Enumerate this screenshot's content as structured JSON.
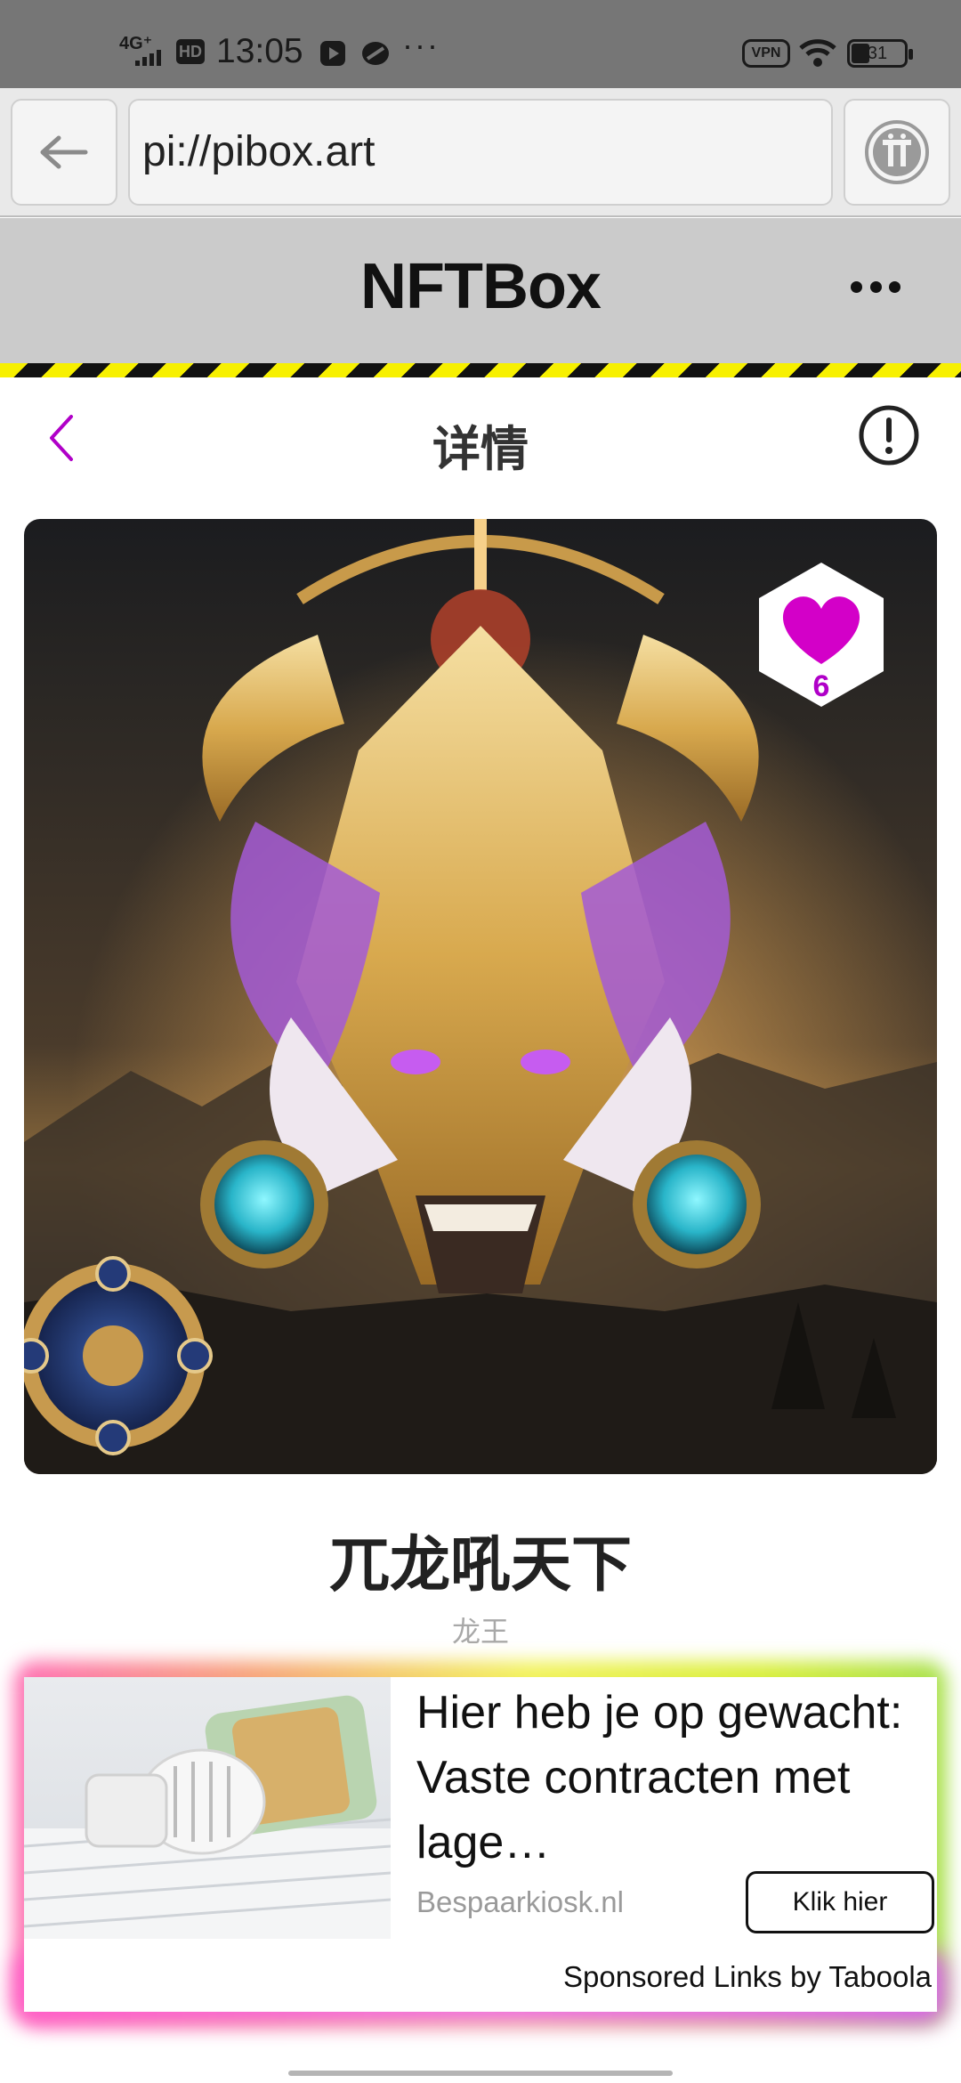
{
  "status_bar": {
    "network": "4G⁺",
    "hd": "HD",
    "time": "13:05",
    "more": "···",
    "vpn": "VPN",
    "battery": "31"
  },
  "browser": {
    "url": "pi://pibox.art",
    "icons": {
      "back": "arrow-left-icon",
      "pi": "pi-coin-icon"
    }
  },
  "app": {
    "title": "NFTBox",
    "menu_icon": "more-horizontal-icon"
  },
  "page": {
    "title": "详情",
    "back_icon": "chevron-left-icon",
    "info_icon": "info-icon"
  },
  "nft": {
    "likes": "6",
    "title": "兀龙吼天下",
    "subtitle": "龙王",
    "like_color": "#d300c8"
  },
  "ad": {
    "headline": "Hier heb je op gewacht: Vaste contracten met lage…",
    "source": "Bespaarkiosk.nl",
    "cta": "Klik hier",
    "sponsor": "Sponsored Links by Taboola"
  },
  "colors": {
    "accent": "#b000c8",
    "hazard_yellow": "#f7f000"
  }
}
